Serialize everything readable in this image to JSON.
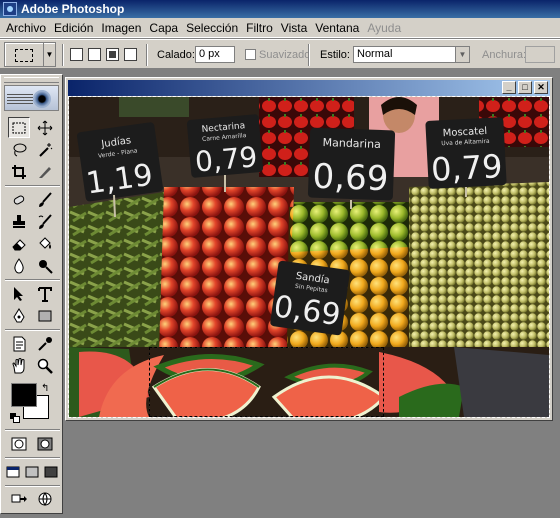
{
  "app": {
    "title": "Adobe Photoshop"
  },
  "menu": [
    "Archivo",
    "Edición",
    "Imagen",
    "Capa",
    "Selección",
    "Filtro",
    "Vista",
    "Ventana",
    "Ayuda"
  ],
  "options": {
    "feather_label": "Calado:",
    "feather_value": "0 px",
    "antialias_label": "Suavizado",
    "style_label": "Estilo:",
    "style_value": "Normal",
    "width_label": "Anchura:"
  },
  "document": {
    "buttons": {
      "minimize": "_",
      "maximize": "□",
      "close": "✕"
    },
    "signs": [
      {
        "name": "Judías",
        "subtitle": "Verde - Plana",
        "price": "1,19"
      },
      {
        "name": "Nectarina",
        "subtitle": "Carne Amarilla",
        "price": "0,79"
      },
      {
        "name": "Mandarina",
        "subtitle": "",
        "price": "0,69"
      },
      {
        "name": "Moscatel",
        "subtitle": "Uva de Altamira",
        "price": "0,79"
      },
      {
        "name": "Sandía",
        "subtitle": "Sin Pepitas",
        "price": "0,69"
      }
    ]
  },
  "colors": {
    "foreground": "#000000",
    "background": "#ffffff",
    "accent": "#0a246a"
  }
}
